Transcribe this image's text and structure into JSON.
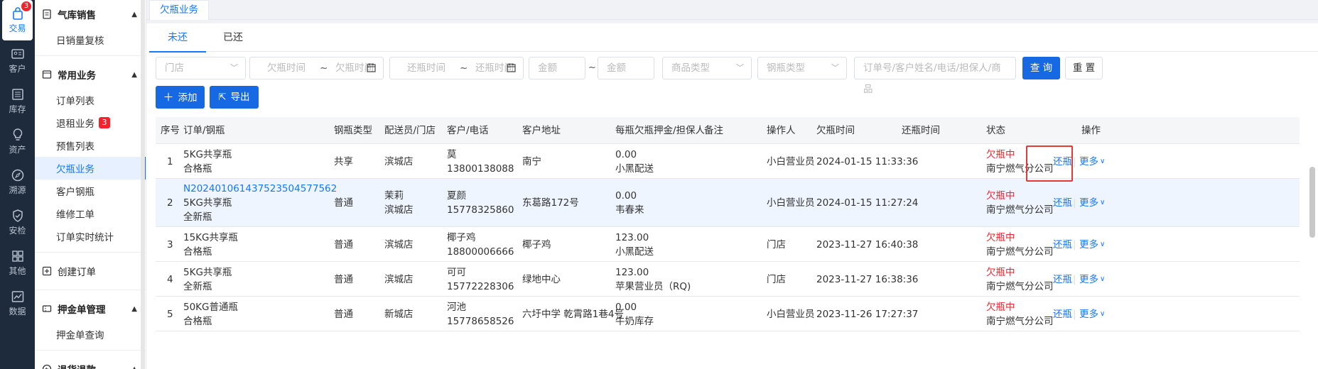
{
  "rail": [
    {
      "label": "交易",
      "icon": "bag-icon",
      "badge": "3",
      "active": true
    },
    {
      "label": "客户",
      "icon": "id-card-icon"
    },
    {
      "label": "库存",
      "icon": "inventory-icon"
    },
    {
      "label": "资产",
      "icon": "lightbulb-icon"
    },
    {
      "label": "溯源",
      "icon": "compass-icon"
    },
    {
      "label": "安检",
      "icon": "shield-check-icon"
    },
    {
      "label": "其他",
      "icon": "grid-icon"
    },
    {
      "label": "数据",
      "icon": "chart-icon"
    }
  ],
  "menu": {
    "group1": "气库销售",
    "group1_items": [
      "日销量复核"
    ],
    "group2": "常用业务",
    "group2_items": [
      "订单列表",
      "退租业务",
      "预售列表",
      "欠瓶业务",
      "客户钢瓶",
      "维修工单",
      "订单实时统计"
    ],
    "return_badge": "3",
    "create_order": "创建订单",
    "group3": "押金单管理",
    "group3_items": [
      "押金单查询"
    ],
    "group4": "退货退款"
  },
  "page_tab": "欠瓶业务",
  "subtabs": [
    "未还",
    "已还"
  ],
  "filters": {
    "store": "门店",
    "owe_start": "欠瓶时间",
    "owe_end": "欠瓶时间",
    "return_start": "还瓶时间",
    "return_end": "还瓶时间",
    "amount_min": "金额",
    "amount_max": "金额",
    "goods_type": "商品类型",
    "cylinder_type": "钢瓶类型",
    "keyword": "订单号/客户姓名/电话/担保人/商品",
    "tilde": "~"
  },
  "buttons": {
    "query": "查 询",
    "reset": "重 置",
    "add": "添加",
    "export": "导出"
  },
  "table": {
    "headers": [
      "序号",
      "订单/钢瓶",
      "钢瓶类型",
      "配送员/门店",
      "客户/电话",
      "客户地址",
      "每瓶欠瓶押金/担保人",
      "备注",
      "操作人",
      "欠瓶时间",
      "还瓶时间",
      "状态",
      "操作"
    ],
    "rows": [
      {
        "no": "1",
        "order": "",
        "goods": "5KG共享瓶",
        "cyl": "合格瓶",
        "type": "共享",
        "courier": "",
        "store": "滨城店",
        "customer": "莫",
        "phone": "13800138088",
        "address": "南宁",
        "deposit": "0.00",
        "guarantor": "小黑配送",
        "remark": "",
        "operator": "小白营业员",
        "owe_time": "2024-01-15 11:33:36",
        "return_time": "",
        "status": "欠瓶中",
        "company": "南宁燃气分公司",
        "act_return": "还瓶",
        "act_more": "更多"
      },
      {
        "no": "2",
        "order": "N20240106143752350457756​2",
        "goods": "5KG共享瓶",
        "cyl": "全新瓶",
        "type": "普通",
        "courier": "茉莉",
        "store": "滨城店",
        "customer": "夏颜",
        "phone": "15778325860",
        "address": "东葛路172号",
        "deposit": "0.00",
        "guarantor": "韦春来",
        "remark": "",
        "operator": "小白营业员",
        "owe_time": "2024-01-15 11:27:24",
        "return_time": "",
        "status": "欠瓶中",
        "company": "南宁燃气分公司",
        "act_return": "还瓶",
        "act_more": "更多"
      },
      {
        "no": "3",
        "order": "",
        "goods": "15KG共享瓶",
        "cyl": "合格瓶",
        "type": "普通",
        "courier": "",
        "store": "滨城店",
        "customer": "椰子鸡",
        "phone": "18800006666",
        "address": "椰子鸡",
        "deposit": "123.00",
        "guarantor": "小黑配送",
        "remark": "",
        "operator": "门店",
        "owe_time": "2023-11-27 16:40:38",
        "return_time": "",
        "status": "欠瓶中",
        "company": "南宁燃气分公司",
        "act_return": "还瓶",
        "act_more": "更多"
      },
      {
        "no": "4",
        "order": "",
        "goods": "5KG共享瓶",
        "cyl": "全新瓶",
        "type": "普通",
        "courier": "",
        "store": "滨城店",
        "customer": "可可",
        "phone": "15772228306",
        "address": "绿地中心",
        "deposit": "123.00",
        "guarantor": "苹果营业员（RQ)",
        "remark": "",
        "operator": "门店",
        "owe_time": "2023-11-27 16:38:36",
        "return_time": "",
        "status": "欠瓶中",
        "company": "南宁燃气分公司",
        "act_return": "还瓶",
        "act_more": "更多"
      },
      {
        "no": "5",
        "order": "",
        "goods": "50KG普通瓶",
        "cyl": "合格瓶",
        "type": "普通",
        "courier": "",
        "store": "新城店",
        "customer": "河池",
        "phone": "15778658526",
        "address": "六圩中学 乾霄路1巷4号",
        "deposit": "0.00",
        "guarantor": "牛奶库存",
        "remark": "",
        "operator": "小白营业员",
        "owe_time": "2023-11-26 17:27:37",
        "return_time": "",
        "status": "欠瓶中",
        "company": "南宁燃气分公司",
        "act_return": "还瓶",
        "act_more": "更多"
      }
    ]
  },
  "colors": {
    "primary": "#1668e3",
    "link": "#1677ff",
    "danger": "#f5222d",
    "rail_bg": "#1e2b3c"
  }
}
